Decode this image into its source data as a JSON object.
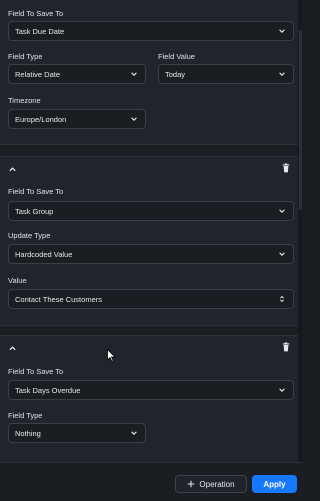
{
  "blocks": [
    {
      "fields": [
        {
          "label": "Field To Save To",
          "value": "Task Due Date",
          "control": "select"
        },
        {
          "label": "Field Type",
          "value": "Relative Date",
          "control": "select"
        },
        {
          "label": "Field Value",
          "value": "Today",
          "control": "select"
        },
        {
          "label": "Timezone",
          "value": "Europe/London",
          "control": "select"
        }
      ]
    },
    {
      "fields": [
        {
          "label": "Field To Save To",
          "value": "Task Group",
          "control": "select"
        },
        {
          "label": "Update Type",
          "value": "Hardcoded Value",
          "control": "select"
        },
        {
          "label": "Value",
          "value": "Contact These Customers",
          "control": "select-updown"
        }
      ]
    },
    {
      "fields": [
        {
          "label": "Field To Save To",
          "value": "Task Days Overdue",
          "control": "select"
        },
        {
          "label": "Field Type",
          "value": "Nothing",
          "control": "select"
        }
      ]
    }
  ],
  "footer": {
    "operation_label": "Operation",
    "apply_label": "Apply"
  },
  "colors": {
    "accent": "#1677ff",
    "panel_bg": "#20252b",
    "page_bg": "#1a1e23"
  },
  "icons": [
    "chevron-down-icon",
    "chevron-up-icon",
    "trash-icon",
    "plus-icon",
    "updown-icon",
    "cursor-icon"
  ]
}
